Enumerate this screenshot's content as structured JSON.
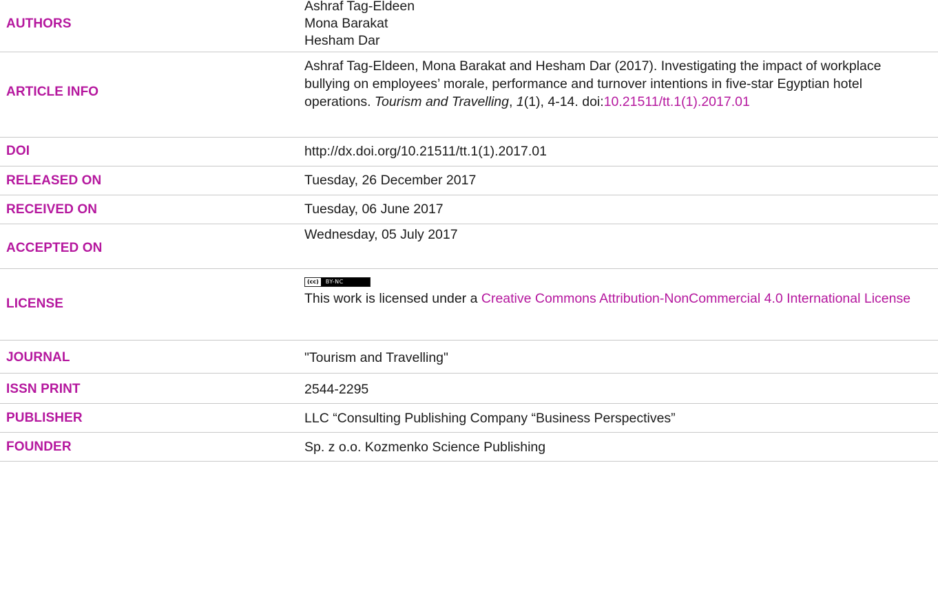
{
  "theme": {
    "accent_color": "#b5179e",
    "link_color": "#b5179e"
  },
  "rows": {
    "authors": {
      "label": "AUTHORS",
      "names": [
        "Ashraf Tag-Eldeen",
        "Mona Barakat",
        "Hesham Dar"
      ]
    },
    "article_info": {
      "label": "ARTICLE INFO",
      "text_before": "Ashraf Tag-Eldeen, Mona Barakat and Hesham Dar (2017). Investigating the impact of workplace bullying on employees’ morale, performance and turnover intentions in five-star Egyptian hotel operations. ",
      "journal_italic": "Tourism and Travelling",
      "comma": ", ",
      "volume_italic": "1",
      "issue_pages": "(1), 4-14. doi:",
      "doi_link": "10.21511/tt.1(1).2017.01"
    },
    "doi": {
      "label": "DOI",
      "value": "http://dx.doi.org/10.21511/tt.1(1).2017.01"
    },
    "released_on": {
      "label": "RELEASED ON",
      "value": "Tuesday, 26 December 2017"
    },
    "received_on": {
      "label": "RECEIVED ON",
      "value": "Tuesday, 06 June 2017"
    },
    "accepted_on": {
      "label": "ACCEPTED ON",
      "value": "Wednesday, 05 July 2017"
    },
    "license": {
      "label": "LICENSE",
      "badge_cc": "(cc)",
      "badge_text": "BY-NC",
      "text_before": "This work is licensed under a ",
      "link_text": "Creative Commons Attribution-NonCommercial 4.0 International License"
    },
    "journal": {
      "label": "JOURNAL",
      "value": "\"Tourism and Travelling\""
    },
    "issn_print": {
      "label": "ISSN PRINT",
      "value": "2544-2295"
    },
    "publisher": {
      "label": "PUBLISHER",
      "value": "LLC “Consulting Publishing Company “Business Perspectives”"
    },
    "founder": {
      "label": "FOUNDER",
      "value": "Sp. z o.o. Kozmenko Science Publishing"
    }
  }
}
